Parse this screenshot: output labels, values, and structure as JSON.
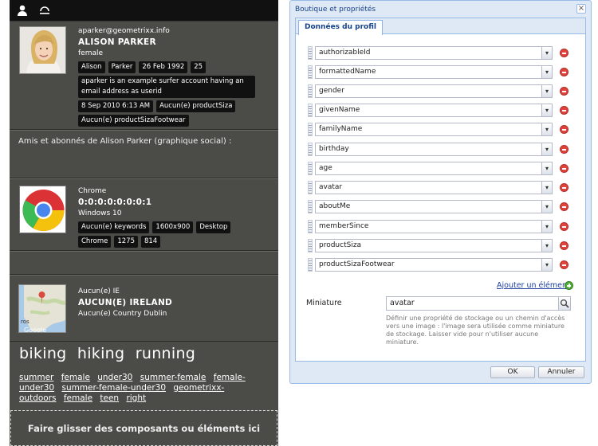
{
  "profile": {
    "email": "aparker@geometrixx.info",
    "name": "ALISON PARKER",
    "gender": "female",
    "chips_row1": [
      "Alison",
      "Parker",
      "26 Feb 1992",
      "25"
    ],
    "about": "aparker is an example surfer account having an email address as userid",
    "member_since": "8 Sep 2010 6:13 AM",
    "product_size": "Aucun(e) productSiza",
    "product_size_footwear": "Aucun(e) productSizaFootwear"
  },
  "social": {
    "title": "Amis et abonnés de Alison Parker (graphique social) :"
  },
  "browser": {
    "name": "Chrome",
    "ip": "0:0:0:0:0:0:0:1",
    "os": "Windows 10",
    "chips_row1": [
      "Aucun(e) keywords",
      "1600x900",
      "Desktop"
    ],
    "chips_row2": [
      "Chrome",
      "1275",
      "814"
    ]
  },
  "geo": {
    "browser": "Aucun(e) IE",
    "country": "AUCUN(E) IRELAND",
    "city": "Aucun(e) Country Dublin",
    "map_brand": "Google",
    "map_label": "ros"
  },
  "interests": [
    "biking",
    "hiking",
    "running"
  ],
  "tags": [
    "summer",
    "female",
    "under30",
    "summer-female",
    "female-under30",
    "summer-female-under30",
    "geometrixx-outdoors",
    "female",
    "teen",
    "right"
  ],
  "dropzone_label": "Faire glisser des composants ou éléments ici",
  "dialog": {
    "title": "Boutique et propriétés",
    "close_glyph": "×",
    "tab": "Données du profil",
    "properties": [
      "authorizableId",
      "formattedName",
      "gender",
      "givenName",
      "familyName",
      "birthday",
      "age",
      "avatar",
      "aboutMe",
      "memberSince",
      "productSiza",
      "productSizaFootwear"
    ],
    "add_label": "Ajouter un élément",
    "thumbnail_label": "Miniature",
    "thumbnail_value": "avatar",
    "thumbnail_help": "Définir une propriété de stockage ou un chemin d'accès vers une image : l'image sera utilisée comme miniature de stockage. Laisser vide pour n'utiliser aucune miniature.",
    "ok": "OK",
    "cancel": "Annuler"
  },
  "icons": {
    "topbar": [
      "user-icon",
      "loader-icon"
    ],
    "remove": "remove-icon",
    "add": "add-icon",
    "search": "search-icon"
  }
}
